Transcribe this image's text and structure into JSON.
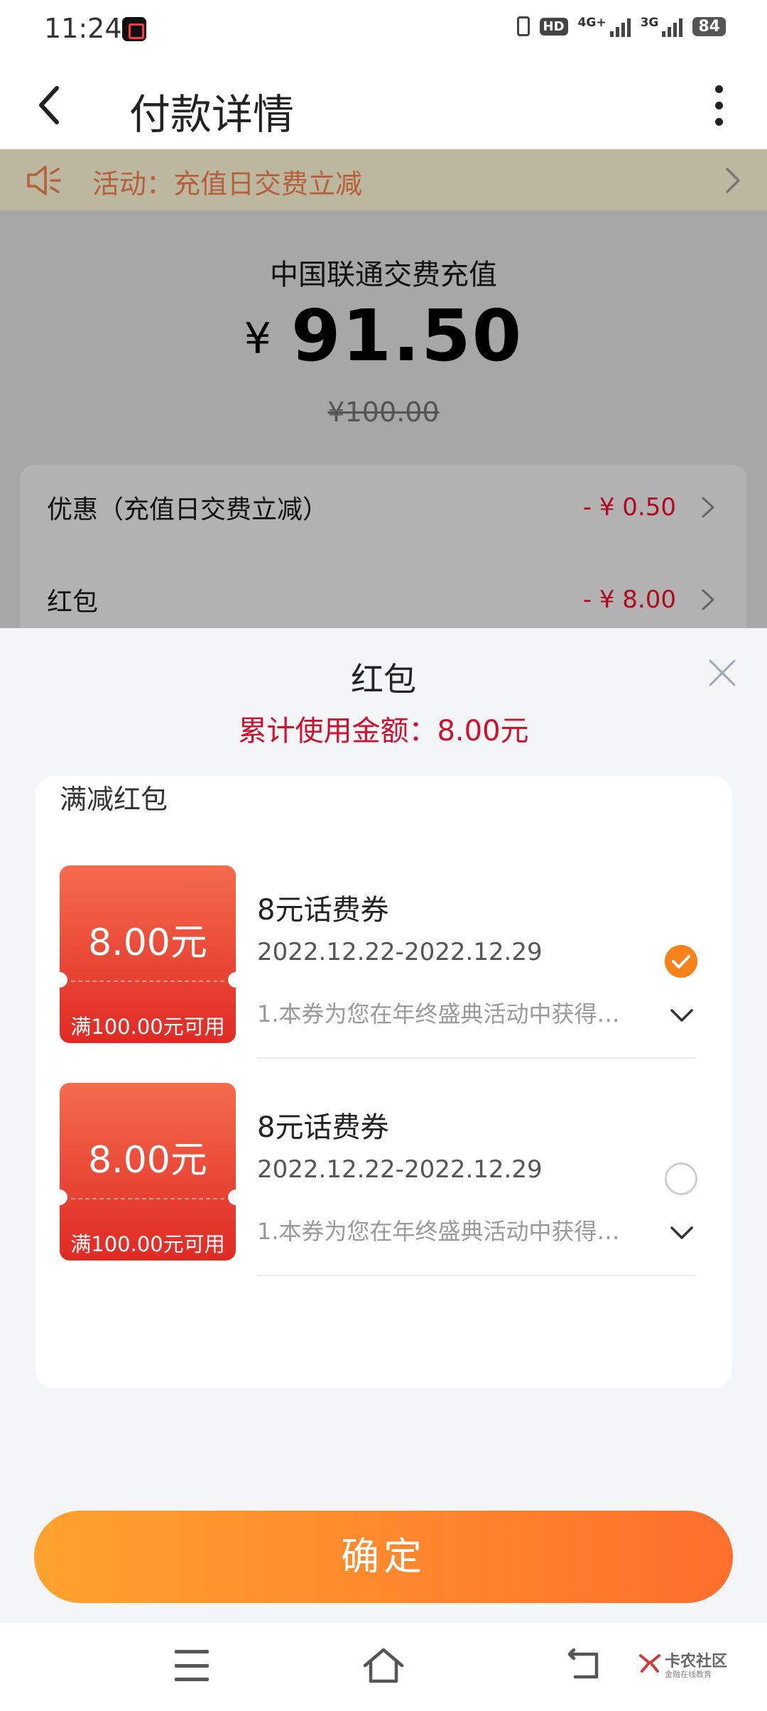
{
  "status_bar": {
    "time": "11:24",
    "hd_label": "HD",
    "sim1_network": "4G+",
    "sim2_network": "3G",
    "battery": "84"
  },
  "header": {
    "title": "付款详情"
  },
  "banner": {
    "text": "活动：充值日交费立减"
  },
  "summary": {
    "product": "中国联通交费充值",
    "currency_symbol": "¥",
    "amount": "91.50",
    "original_price": "¥100.00",
    "rows": [
      {
        "label": "优惠（充值日交费立减）",
        "value": "- ¥ 0.50"
      },
      {
        "label": "红包",
        "value": "- ¥ 8.00"
      }
    ]
  },
  "sheet": {
    "title": "红包",
    "total_used": "累计使用金额：8.00元",
    "section_heading": "满减红包",
    "coupons": [
      {
        "value": "8.00元",
        "condition": "满100.00元可用",
        "name": "8元话费券",
        "date_range": "2022.12.22-2022.12.29",
        "description": "1.本券为您在年终盛典活动中获得…",
        "selected": true
      },
      {
        "value": "8.00元",
        "condition": "满100.00元可用",
        "name": "8元话费券",
        "date_range": "2022.12.22-2022.12.29",
        "description": "1.本券为您在年终盛典活动中获得…",
        "selected": false
      }
    ],
    "confirm_label": "确定"
  },
  "watermark": {
    "main": "卡农社区",
    "sub": "金融在线教育"
  },
  "colors": {
    "accent_orange": "#f7821c",
    "price_red": "#b00a1e",
    "total_red": "#d0102c",
    "coupon_red": "#e02a24",
    "banner_text": "#b5603a"
  }
}
